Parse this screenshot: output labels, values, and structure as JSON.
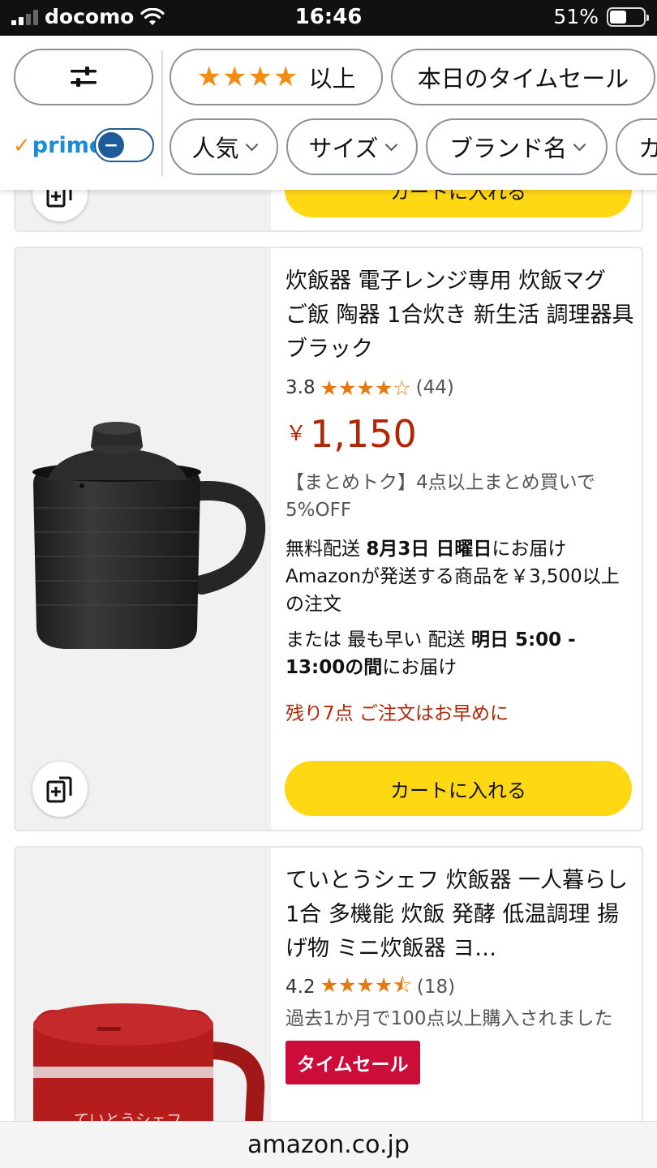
{
  "status_bar": {
    "carrier": "docomo",
    "time": "16:46",
    "battery": "51%",
    "battery_level": 0.51
  },
  "filters": {
    "settings_icon": "sliders-icon",
    "rating_filter": {
      "stars": "★★★★",
      "label": "以上"
    },
    "timesale_label": "本日のタイムセール",
    "prime_label": "prime",
    "prime_toggle_symbol": "−",
    "chips": [
      "人気",
      "サイズ",
      "ブランド名",
      "カ"
    ]
  },
  "prev_card": {
    "cart_label": "カートに入れる"
  },
  "products": [
    {
      "title": "炊飯器 電子レンジ専用 炊飯マグ ご飯 陶器 1合炊き 新生活 調理器具 ブラック",
      "rating": "3.8",
      "stars": "★★★★☆",
      "review_count": "(44)",
      "price_symbol": "￥",
      "price": "1,150",
      "promo": "【まとめトク】4点以上まとめ買いで5%OFF",
      "ship_line1_prefix": "無料配送 ",
      "ship_date": "8月3日 日曜日",
      "ship_line1_suffix": "にお届け",
      "ship_condition": "Amazonが発送する商品を￥3,500以上の注文",
      "fast_prefix": "または 最も早い 配送 ",
      "fast_window": "明日 5:00 - 13:00の間",
      "fast_suffix": "にお届け",
      "stock": "残り7点 ご注文はお早めに",
      "cart_label": "カートに入れる"
    },
    {
      "title": "ていとうシェフ 炊飯器 一人暮らし 1合 多機能 炊飯 発酵 低温調理 揚げ物 ミニ炊飯器 ヨ…",
      "rating": "4.2",
      "stars": "★★★★⯪",
      "review_count": "(18)",
      "bought": "過去1か月で100点以上購入されました",
      "badge": "タイムセール",
      "product_text": "ていとうシェフ"
    }
  ],
  "url_bar": {
    "domain": "amazon.co.jp"
  },
  "colors": {
    "price": "#b12704",
    "cart_button": "#ffd814",
    "star": "#e47911",
    "badge": "#cc0c39",
    "prime_blue": "#1d5b99"
  }
}
